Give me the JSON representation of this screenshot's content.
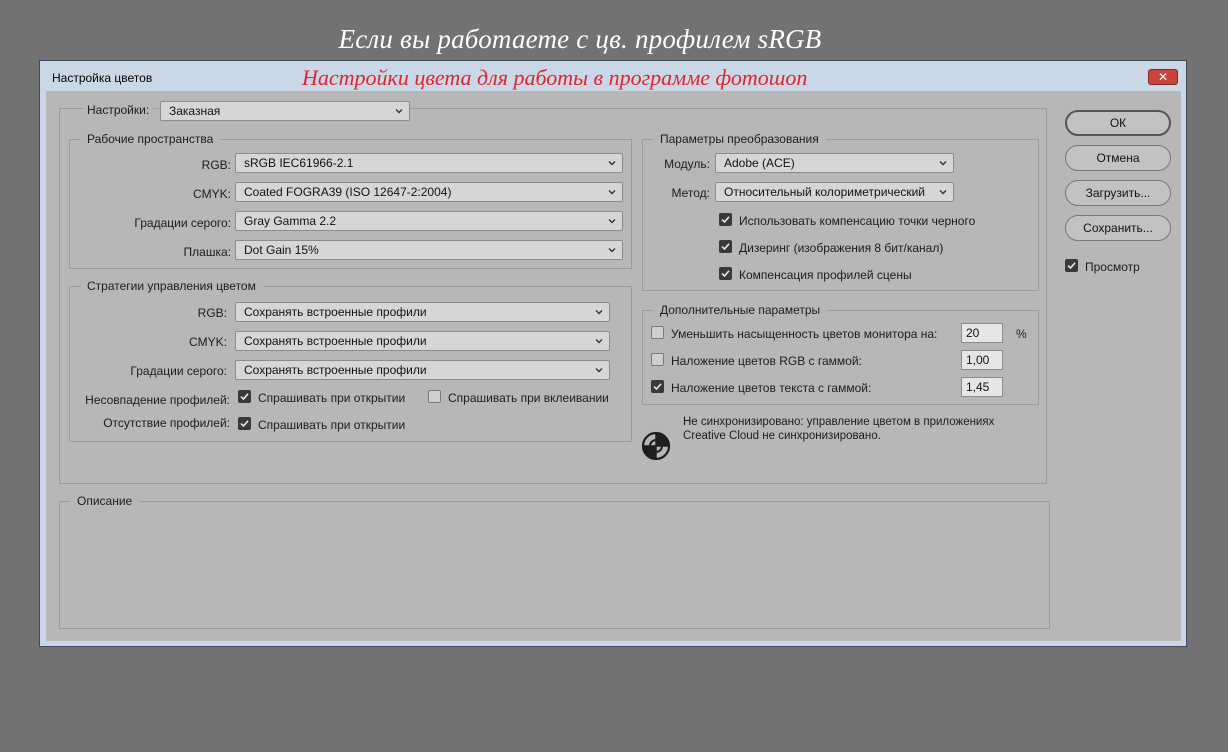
{
  "captions": {
    "top": "Если вы работаете с цв. профилем sRGB",
    "red": "Настройки цвета для работы в программе фотошоп"
  },
  "window": {
    "title": "Настройка цветов",
    "close_icon": "close-icon"
  },
  "settings": {
    "label": "Настройки:",
    "value": "Заказная"
  },
  "working_spaces": {
    "title": "Рабочие пространства",
    "rgb_label": "RGB:",
    "rgb_value": "sRGB IEC61966-2.1",
    "cmyk_label": "CMYK:",
    "cmyk_value": "Coated FOGRA39 (ISO 12647-2:2004)",
    "gray_label": "Градации серого:",
    "gray_value": "Gray Gamma 2.2",
    "spot_label": "Плашка:",
    "spot_value": "Dot Gain 15%"
  },
  "policies": {
    "title": "Стратегии управления цветом",
    "rgb_label": "RGB:",
    "rgb_value": "Сохранять встроенные профили",
    "cmyk_label": "CMYK:",
    "cmyk_value": "Сохранять встроенные профили",
    "gray_label": "Градации серого:",
    "gray_value": "Сохранять встроенные профили",
    "mismatch_label": "Несовпадение профилей:",
    "mismatch_open": "Спрашивать при открытии",
    "mismatch_open_checked": true,
    "mismatch_paste": "Спрашивать при вклеивании",
    "mismatch_paste_checked": false,
    "missing_label": "Отсутствие профилей:",
    "missing_open": "Спрашивать при открытии",
    "missing_open_checked": true
  },
  "conversion": {
    "title": "Параметры преобразования",
    "engine_label": "Модуль:",
    "engine_value": "Adobe (ACE)",
    "intent_label": "Метод:",
    "intent_value": "Относительный колориметрический",
    "bpc": "Использовать компенсацию точки черного",
    "bpc_checked": true,
    "dither": "Дизеринг (изображения 8 бит/канал)",
    "dither_checked": true,
    "scene": "Компенсация профилей сцены",
    "scene_checked": true
  },
  "advanced": {
    "title": "Дополнительные параметры",
    "desaturate": "Уменьшить насыщенность цветов монитора на:",
    "desaturate_checked": false,
    "desaturate_value": "20",
    "desaturate_unit": "%",
    "blend_rgb": "Наложение цветов RGB с гаммой:",
    "blend_rgb_checked": false,
    "blend_rgb_value": "1,00",
    "blend_text": "Наложение цветов текста с гаммой:",
    "blend_text_checked": true,
    "blend_text_value": "1,45"
  },
  "sync": {
    "line1": "Не синхронизировано: управление цветом в приложениях",
    "line2": "Creative Cloud не синхронизировано.",
    "icon": "sync-status-icon"
  },
  "description": {
    "title": "Описание"
  },
  "buttons": {
    "ok": "ОК",
    "cancel": "Отмена",
    "load": "Загрузить...",
    "save": "Сохранить..."
  },
  "preview": {
    "label": "Просмотр",
    "checked": true
  },
  "colors": {
    "dialog_bg": "#b7b7b7",
    "frame": "#c9d7e6",
    "caption_red": "#e2242c"
  }
}
